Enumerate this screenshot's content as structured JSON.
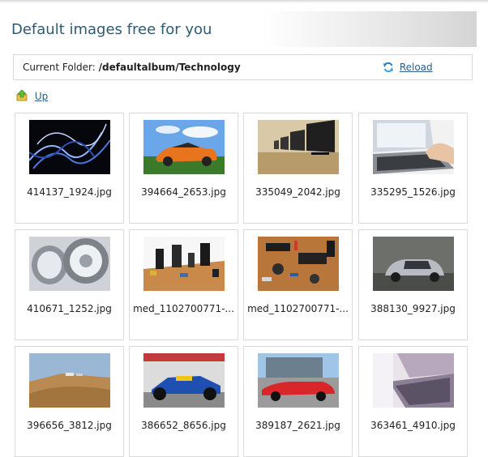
{
  "header": {
    "title": "Default images free for you"
  },
  "folder": {
    "label": "Current Folder:",
    "path": "/defaultalbum/Technology",
    "reload_label": "Reload"
  },
  "nav": {
    "up_label": "Up"
  },
  "images": [
    {
      "caption": "414137_1924.jpg",
      "icon": "light-trails-thumbnail"
    },
    {
      "caption": "394664_2653.jpg",
      "icon": "orange-sports-car-thumbnail"
    },
    {
      "caption": "335049_2042.jpg",
      "icon": "row-of-monitors-thumbnail"
    },
    {
      "caption": "335295_1526.jpg",
      "icon": "laptop-typing-thumbnail"
    },
    {
      "caption": "410671_1252.jpg",
      "icon": "car-headlights-thumbnail"
    },
    {
      "caption": "med_1102700771-...",
      "icon": "circuit-board-thumbnail"
    },
    {
      "caption": "med_1102700771-...",
      "icon": "circuit-board-thumbnail"
    },
    {
      "caption": "388130_9927.jpg",
      "icon": "silver-car-thumbnail"
    },
    {
      "caption": "396656_3812.jpg",
      "icon": "desert-dunes-thumbnail"
    },
    {
      "caption": "386652_8656.jpg",
      "icon": "formula-one-car-thumbnail"
    },
    {
      "caption": "389187_2621.jpg",
      "icon": "red-classic-car-thumbnail"
    },
    {
      "caption": "363461_4910.jpg",
      "icon": "laptop-keyboard-thumbnail"
    }
  ]
}
